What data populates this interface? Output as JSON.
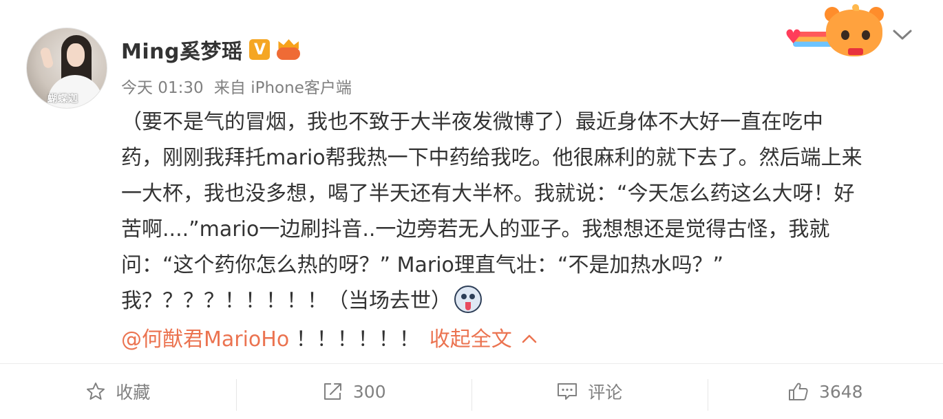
{
  "post": {
    "author": {
      "name": "Ming奚梦瑶",
      "verified_badge": "V",
      "avatar_watermark": "蝴蝶迦"
    },
    "meta": {
      "time": "今天 01:30",
      "source": "来自 iPhone客户端"
    },
    "text_lines": [
      "（要不是气的冒烟，我也不致于大半夜发微博了）最近身体不大好一直在吃中",
      "药，刚刚我拜托mario帮我热一下中药给我吃。他很麻利的就下去了。然后端上来",
      "一大杯，我也没多想，喝了半天还有大半杯。我就说：“今天怎么药这么大呀！好",
      "苦啊....”mario一边刷抖音..一边旁若无人的亚子。我想想还是觉得古怪，我就",
      "问：“这个药你怎么热的呀？” Mario理直气壮：“不是加热水吗？”",
      "我？？？？！！！！！（当场去世）"
    ],
    "mention": "@何猷君MarioHo",
    "after_mention": " ！！！！！！",
    "collapse_label": "收起全文",
    "emoji_name": "dizzy-face-emoji"
  },
  "footer": {
    "favorite_label": "收藏",
    "repost_count": "300",
    "comment_label": "评论",
    "like_count": "3648"
  },
  "icons": {
    "favorite": "star-outline-icon",
    "repost": "share-arrow-icon",
    "comment": "comment-bubble-icon",
    "like": "thumbs-up-icon",
    "menu": "chevron-down-icon"
  },
  "colors": {
    "link": "#eb7350",
    "text": "#333333",
    "meta": "#808080",
    "vip": "#f5a623"
  }
}
